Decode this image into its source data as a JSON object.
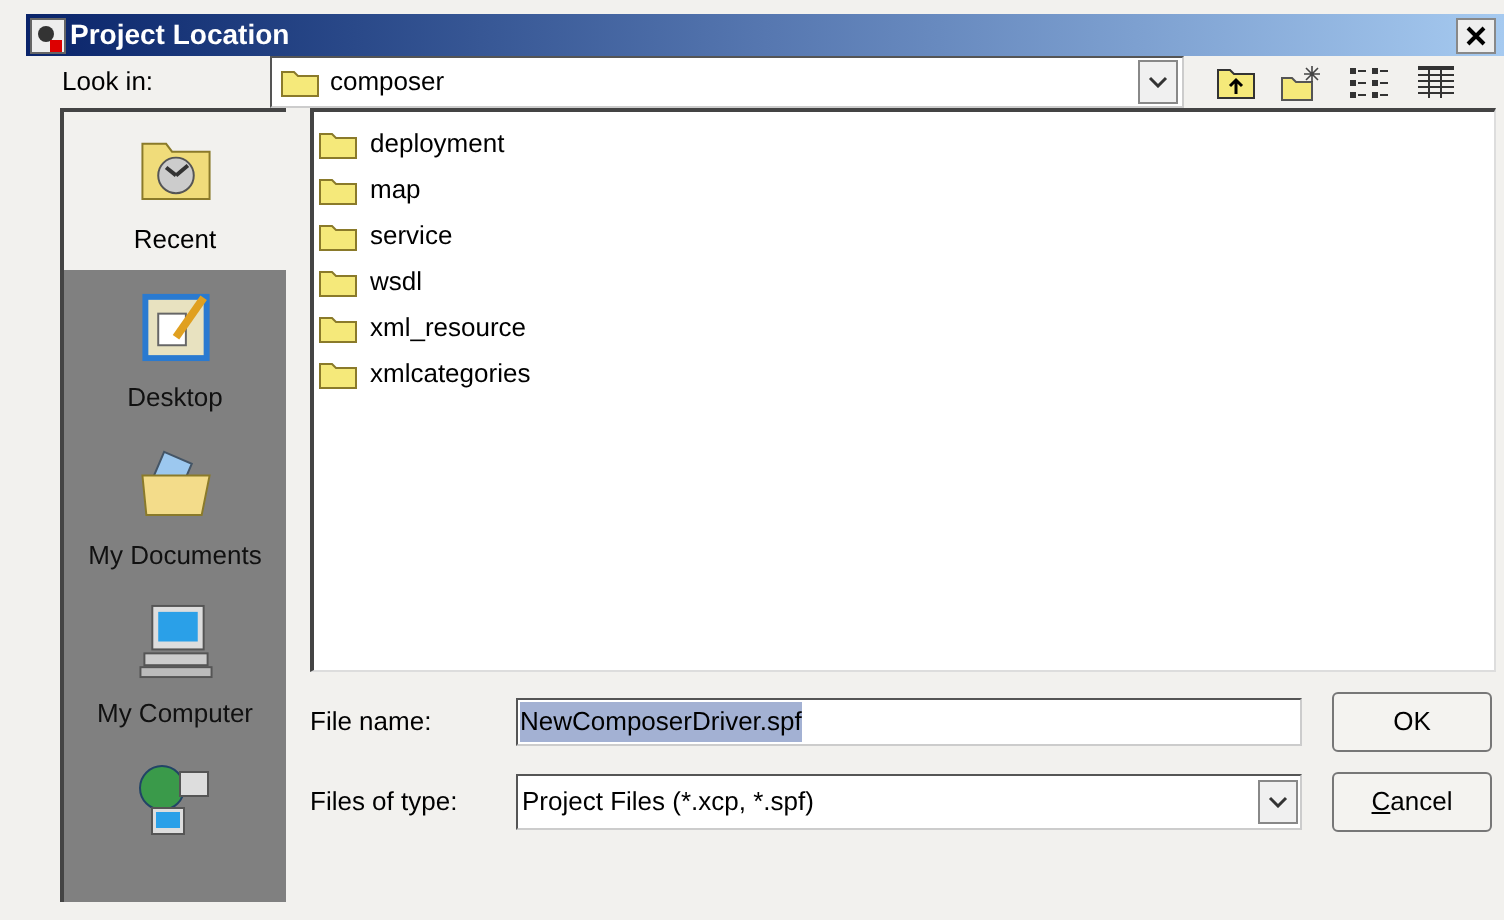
{
  "window": {
    "title": "Project Location"
  },
  "look_in": {
    "label": "Look in:",
    "value": "composer"
  },
  "places": [
    {
      "label": "Recent",
      "kind": "recent",
      "selected": true
    },
    {
      "label": "Desktop",
      "kind": "desktop",
      "selected": false
    },
    {
      "label": "My Documents",
      "kind": "documents",
      "selected": false
    },
    {
      "label": "My Computer",
      "kind": "computer",
      "selected": false
    },
    {
      "kind": "network",
      "selected": false
    }
  ],
  "files": [
    {
      "name": "deployment"
    },
    {
      "name": "map"
    },
    {
      "name": "service"
    },
    {
      "name": "wsdl"
    },
    {
      "name": "xml_resource"
    },
    {
      "name": "xmlcategories"
    }
  ],
  "file_name": {
    "label": "File name:",
    "value": "NewComposerDriver.spf",
    "selected": true
  },
  "file_type": {
    "label": "Files of type:",
    "value": "Project Files (*.xcp, *.spf)"
  },
  "buttons": [
    {
      "label": "OK"
    },
    {
      "label": "Cancel",
      "mnemonic": true
    }
  ]
}
